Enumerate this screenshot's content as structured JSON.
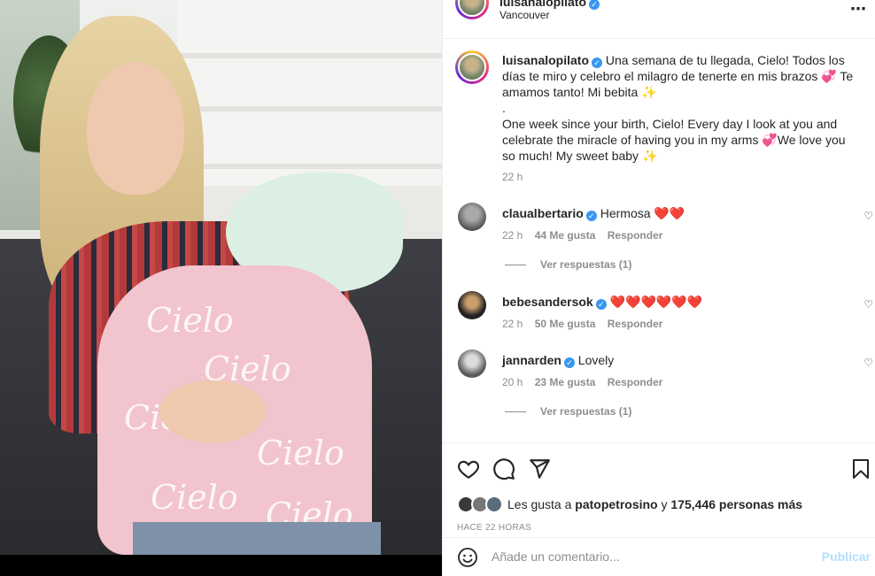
{
  "post": {
    "author": "luisanalopilato",
    "location": "Vancouver",
    "more_icon": "⋯",
    "caption": {
      "author": "luisanalopilato",
      "lines": [
        "Una semana de tu llegada, Cielo! Todos los días te miro y celebro el milagro de tenerte en mis brazos 💞 Te amamos tanto! Mi bebita ✨",
        ".",
        "One week since your birth, Cielo! Every day I look at you and celebrate the miracle of having you in my arms 💞We love you so much! My sweet baby ✨"
      ],
      "time": "22 h"
    },
    "comments": [
      {
        "user": "claualbertario",
        "verified": true,
        "text": "Hermosa ❤️❤️",
        "time": "22 h",
        "likes": "44 Me gusta",
        "reply": "Responder",
        "replies": "Ver respuestas (1)"
      },
      {
        "user": "bebesandersok",
        "verified": true,
        "text": "❤️❤️❤️❤️❤️❤️",
        "time": "22 h",
        "likes": "50 Me gusta",
        "reply": "Responder",
        "replies": ""
      },
      {
        "user": "jannarden",
        "verified": true,
        "text": "Lovely",
        "time": "20 h",
        "likes": "23 Me gusta",
        "reply": "Responder",
        "replies": "Ver respuestas (1)"
      }
    ],
    "likes_prefix": "Les gusta a",
    "likes_user": "patopetrosino",
    "likes_connector": "y",
    "likes_others": "175,446 personas más",
    "timestamp": "HACE 22 HORAS",
    "comment_placeholder": "Añade un comentario...",
    "publish_label": "Publicar",
    "photo_text": [
      "Cielo",
      "Cielo",
      "Cielo",
      "Cielo",
      "Cielo",
      "Cielo"
    ]
  },
  "icons": {
    "like": "heart-icon",
    "comment": "comment-icon",
    "share": "paper-plane-icon",
    "save": "bookmark-icon",
    "emoji": "smiley-icon"
  },
  "colors": {
    "verified": "#3897f0",
    "publish_disabled": "#b2dffc",
    "secondary_text": "#8e8e8e"
  }
}
